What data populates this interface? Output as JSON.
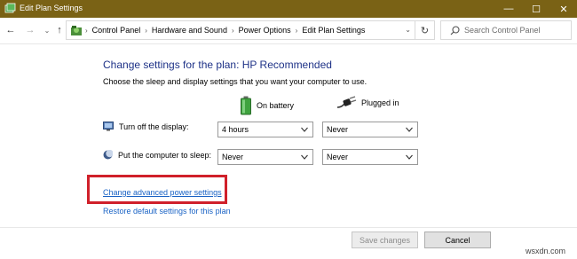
{
  "window": {
    "title": "Edit Plan Settings",
    "controls": {
      "minimize": "—",
      "maximize": "☐",
      "close": "✕"
    }
  },
  "navigation": {
    "back_glyph": "←",
    "forward_glyph": "→",
    "dropdown_glyph": "⌄",
    "up_glyph": "↑",
    "breadcrumbs": [
      "Control Panel",
      "Hardware and Sound",
      "Power Options",
      "Edit Plan Settings"
    ],
    "separator": "›",
    "address_dropdown_glyph": "⌄",
    "refresh_glyph": "↻"
  },
  "search": {
    "placeholder": "Search Control Panel"
  },
  "main": {
    "heading": "Change settings for the plan: HP Recommended",
    "subheading": "Choose the sleep and display settings that you want your computer to use.",
    "columns": {
      "battery": "On battery",
      "plugged": "Plugged in"
    },
    "rows": {
      "display": {
        "label": "Turn off the display:",
        "battery_value": "4 hours",
        "plugged_value": "Never"
      },
      "sleep": {
        "label": "Put the computer to sleep:",
        "battery_value": "Never",
        "plugged_value": "Never"
      }
    },
    "links": {
      "advanced": "Change advanced power settings",
      "restore": "Restore default settings for this plan"
    }
  },
  "footer": {
    "save_label": "Save changes",
    "cancel_label": "Cancel"
  },
  "watermark": "wsxdn.com",
  "colors": {
    "titlebar": "#7a6215",
    "heading": "#1e3287",
    "link": "#1a63c5",
    "highlight": "#d0202a"
  },
  "icons": [
    "app-icon",
    "control-panel-icon",
    "search-icon",
    "battery-icon",
    "plug-icon",
    "display-icon",
    "sleep-moon-icon",
    "chevron-down-icon"
  ]
}
